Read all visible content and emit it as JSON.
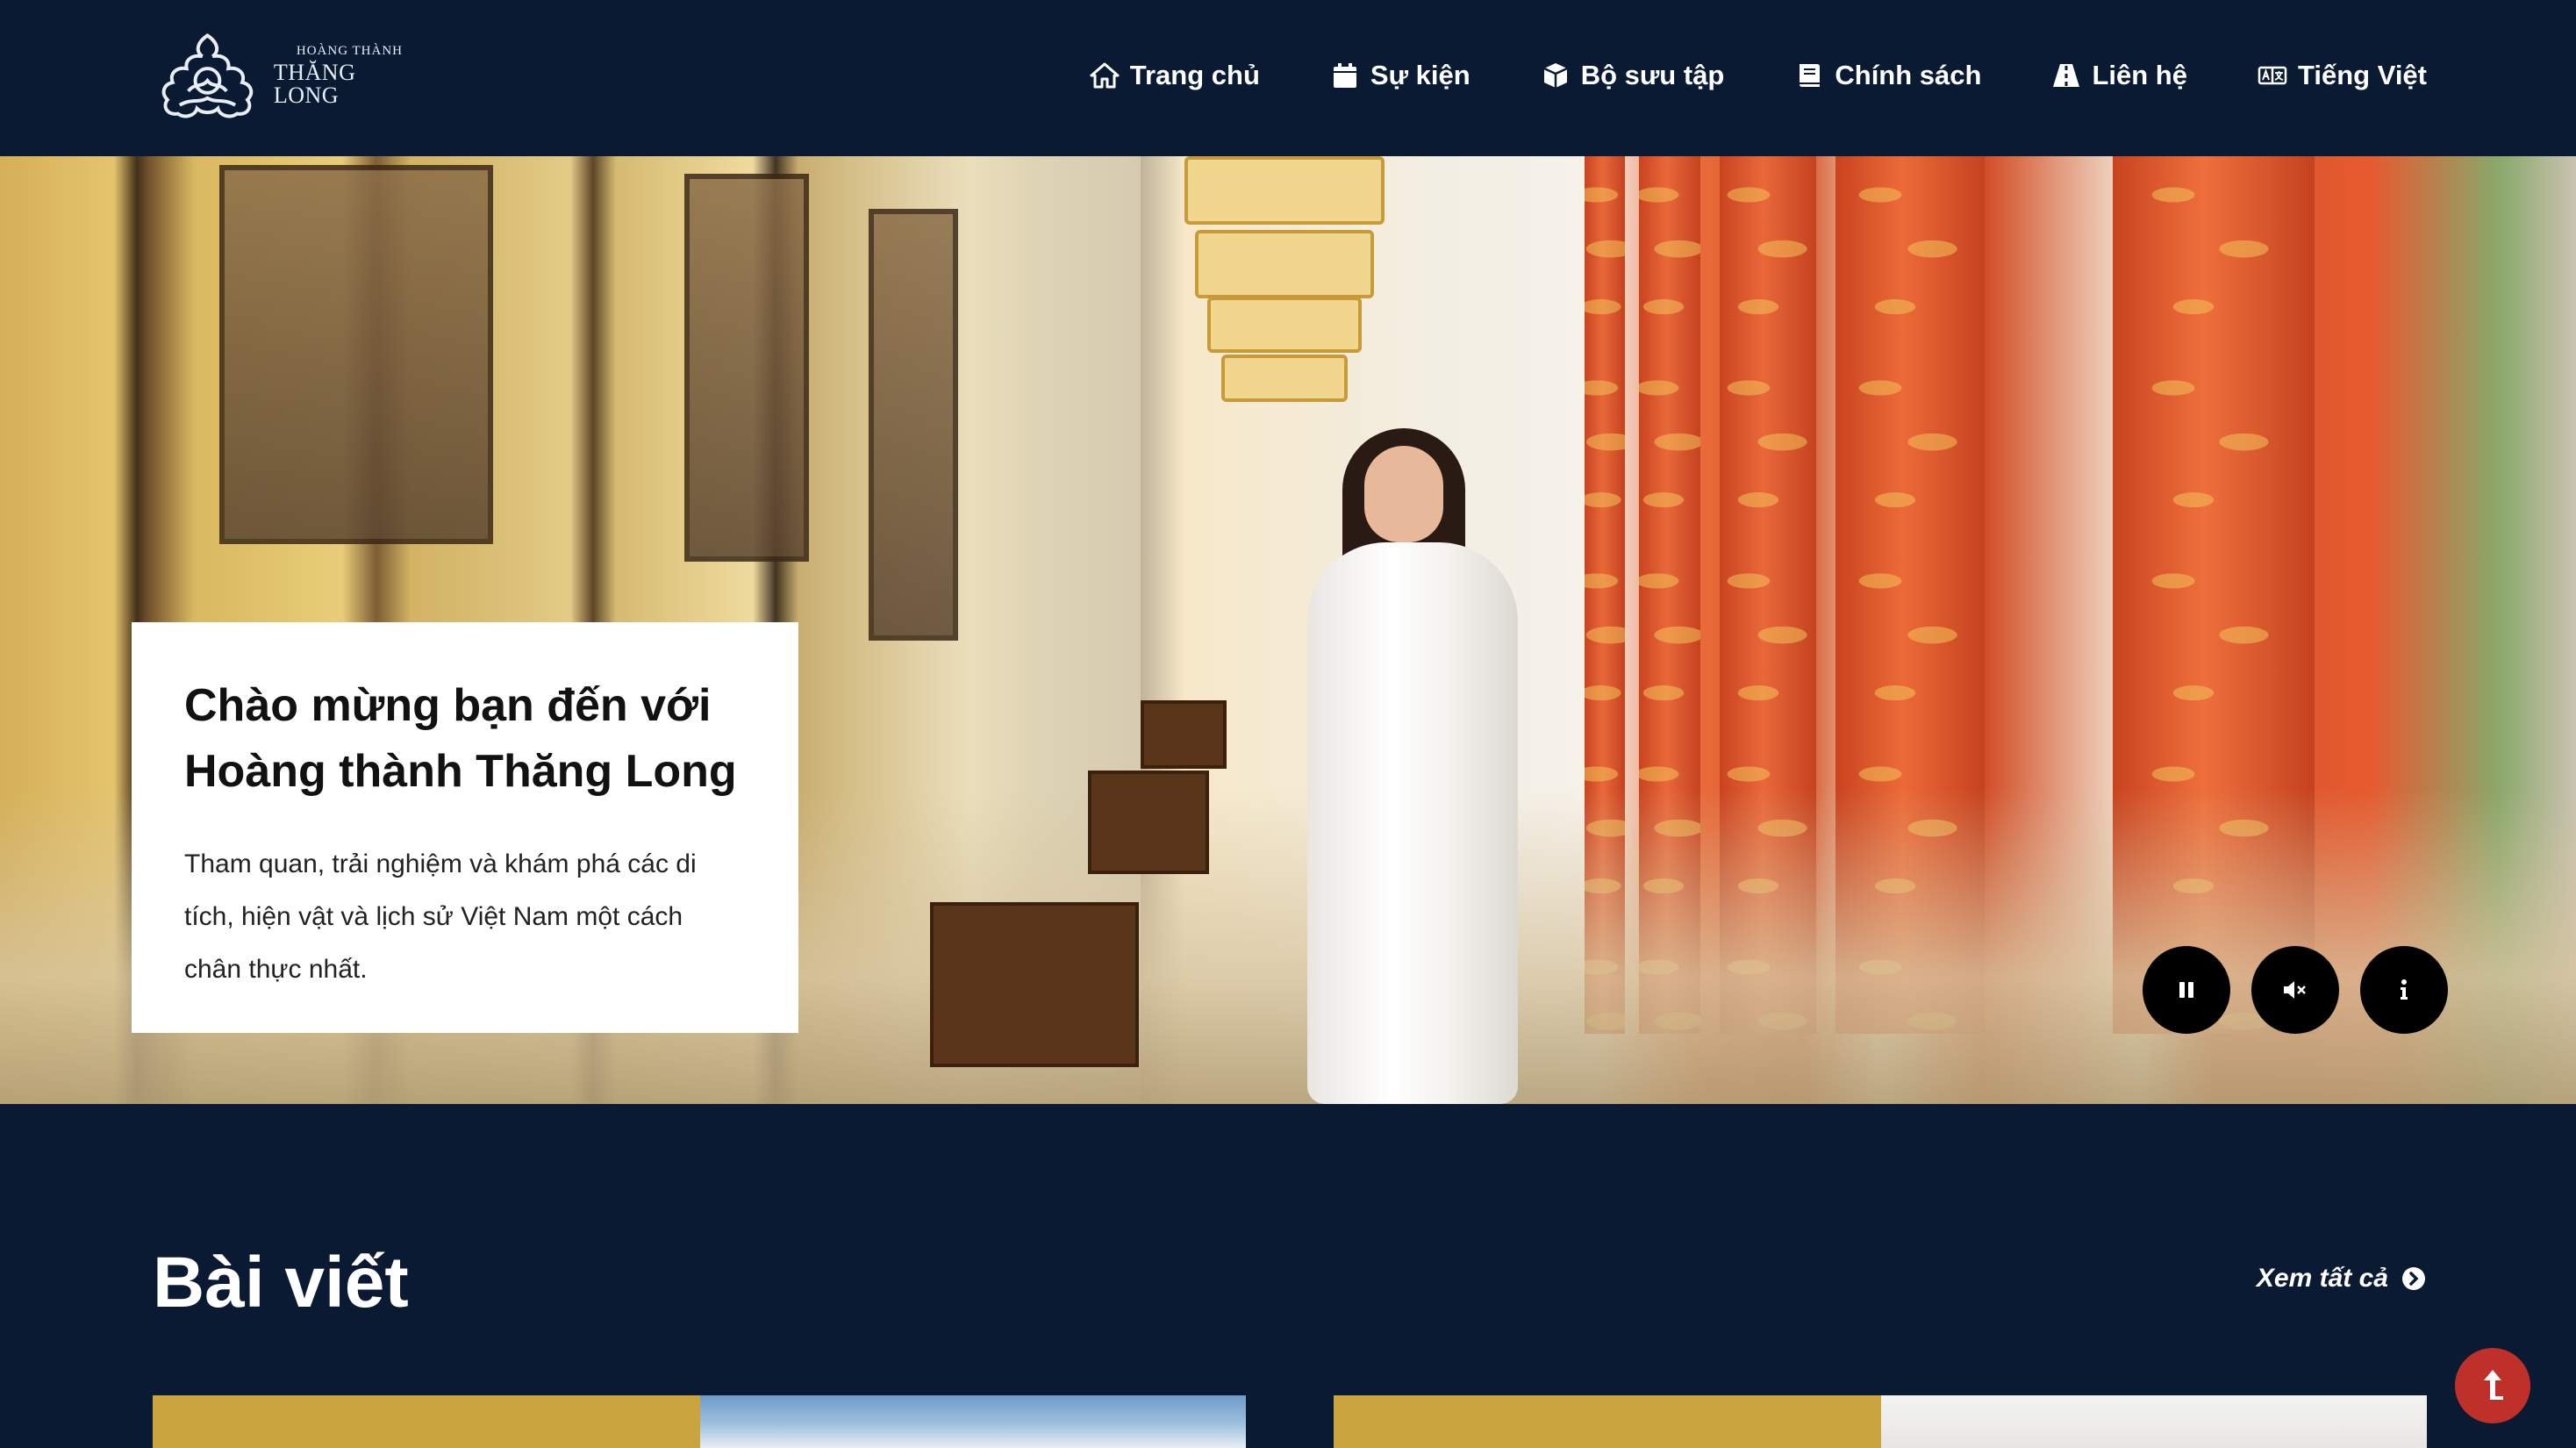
{
  "header": {
    "logo": {
      "line1": "HOÀNG THÀNH",
      "line2": "THĂNG LONG"
    },
    "nav": [
      {
        "label": "Trang chủ",
        "icon": "home-icon"
      },
      {
        "label": "Sự kiện",
        "icon": "calendar-icon"
      },
      {
        "label": "Bộ sưu tập",
        "icon": "cube-icon"
      },
      {
        "label": "Chính sách",
        "icon": "book-icon"
      },
      {
        "label": "Liên hệ",
        "icon": "road-icon"
      },
      {
        "label": "Tiếng Việt",
        "icon": "language-icon"
      }
    ]
  },
  "hero": {
    "title": "Chào mừng bạn đến với Hoàng thành Thăng Long",
    "description": "Tham quan, trải nghiệm và khám phá các di tích, hiện vật và lịch sử Việt Nam một cách chân thực nhất.",
    "controls": [
      "pause-icon",
      "mute-icon",
      "info-icon"
    ]
  },
  "articles": {
    "title": "Bài viết",
    "view_all": "Xem tất cả"
  },
  "colors": {
    "background": "#0b1a33",
    "gold": "#c9a43f",
    "scroll_top": "#c0302a"
  }
}
